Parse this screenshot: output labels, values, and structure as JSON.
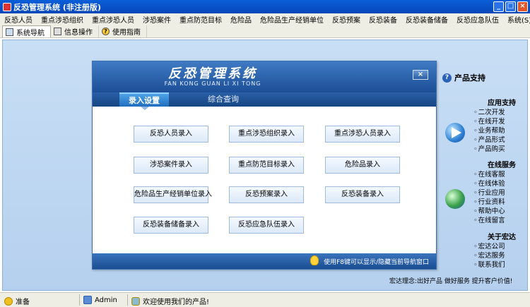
{
  "window": {
    "title": "反恐管理系统 (非注册版)"
  },
  "menu": [
    "反恐人员",
    "重点涉恐组织",
    "重点涉恐人员",
    "涉恐案件",
    "重点防范目标",
    "危险品",
    "危险品生产经销单位",
    "反恐预案",
    "反恐装备",
    "反恐装备储备",
    "反恐应急队伍",
    "系统(S)"
  ],
  "toolbar": {
    "tabs": [
      "系统导航",
      "信息操作",
      "使用指南"
    ]
  },
  "panel": {
    "title": "反恐管理系统",
    "subtitle": "FAN KONG GUAN LI XI TONG",
    "close": "×",
    "tabs": [
      "录入设置",
      "综合查询"
    ],
    "buttons": [
      "反恐人员录入",
      "重点涉恐组织录入",
      "重点涉恐人员录入",
      "涉恐案件录入",
      "重点防范目标录入",
      "危险品录入",
      "危险品生产经销单位录入",
      "反恐预案录入",
      "反恐装备录入",
      "反恐装备储备录入",
      "反恐应急队伍录入"
    ],
    "hint": "使用F8键可以显示/隐藏当前导航窗口"
  },
  "sidebar": {
    "header": "产品支持",
    "sections": [
      {
        "title": "应用支持",
        "items": [
          "二次开发",
          "在线开发",
          "业务帮助",
          "产品形式",
          "产品购买"
        ]
      },
      {
        "title": "在线服务",
        "items": [
          "在线客服",
          "在线体验",
          "行业应用",
          "行业资料",
          "帮助中心",
          "在线留言"
        ]
      },
      {
        "title": "关于宏达",
        "items": [
          "宏达公司",
          "宏达服务",
          "联系我们"
        ]
      }
    ],
    "motto": "宏达理念:出好产品 做好服务 提升客户价值!"
  },
  "status": {
    "ready": "准备",
    "user": "Admin",
    "welcome": "欢迎使用我们的产品!"
  }
}
